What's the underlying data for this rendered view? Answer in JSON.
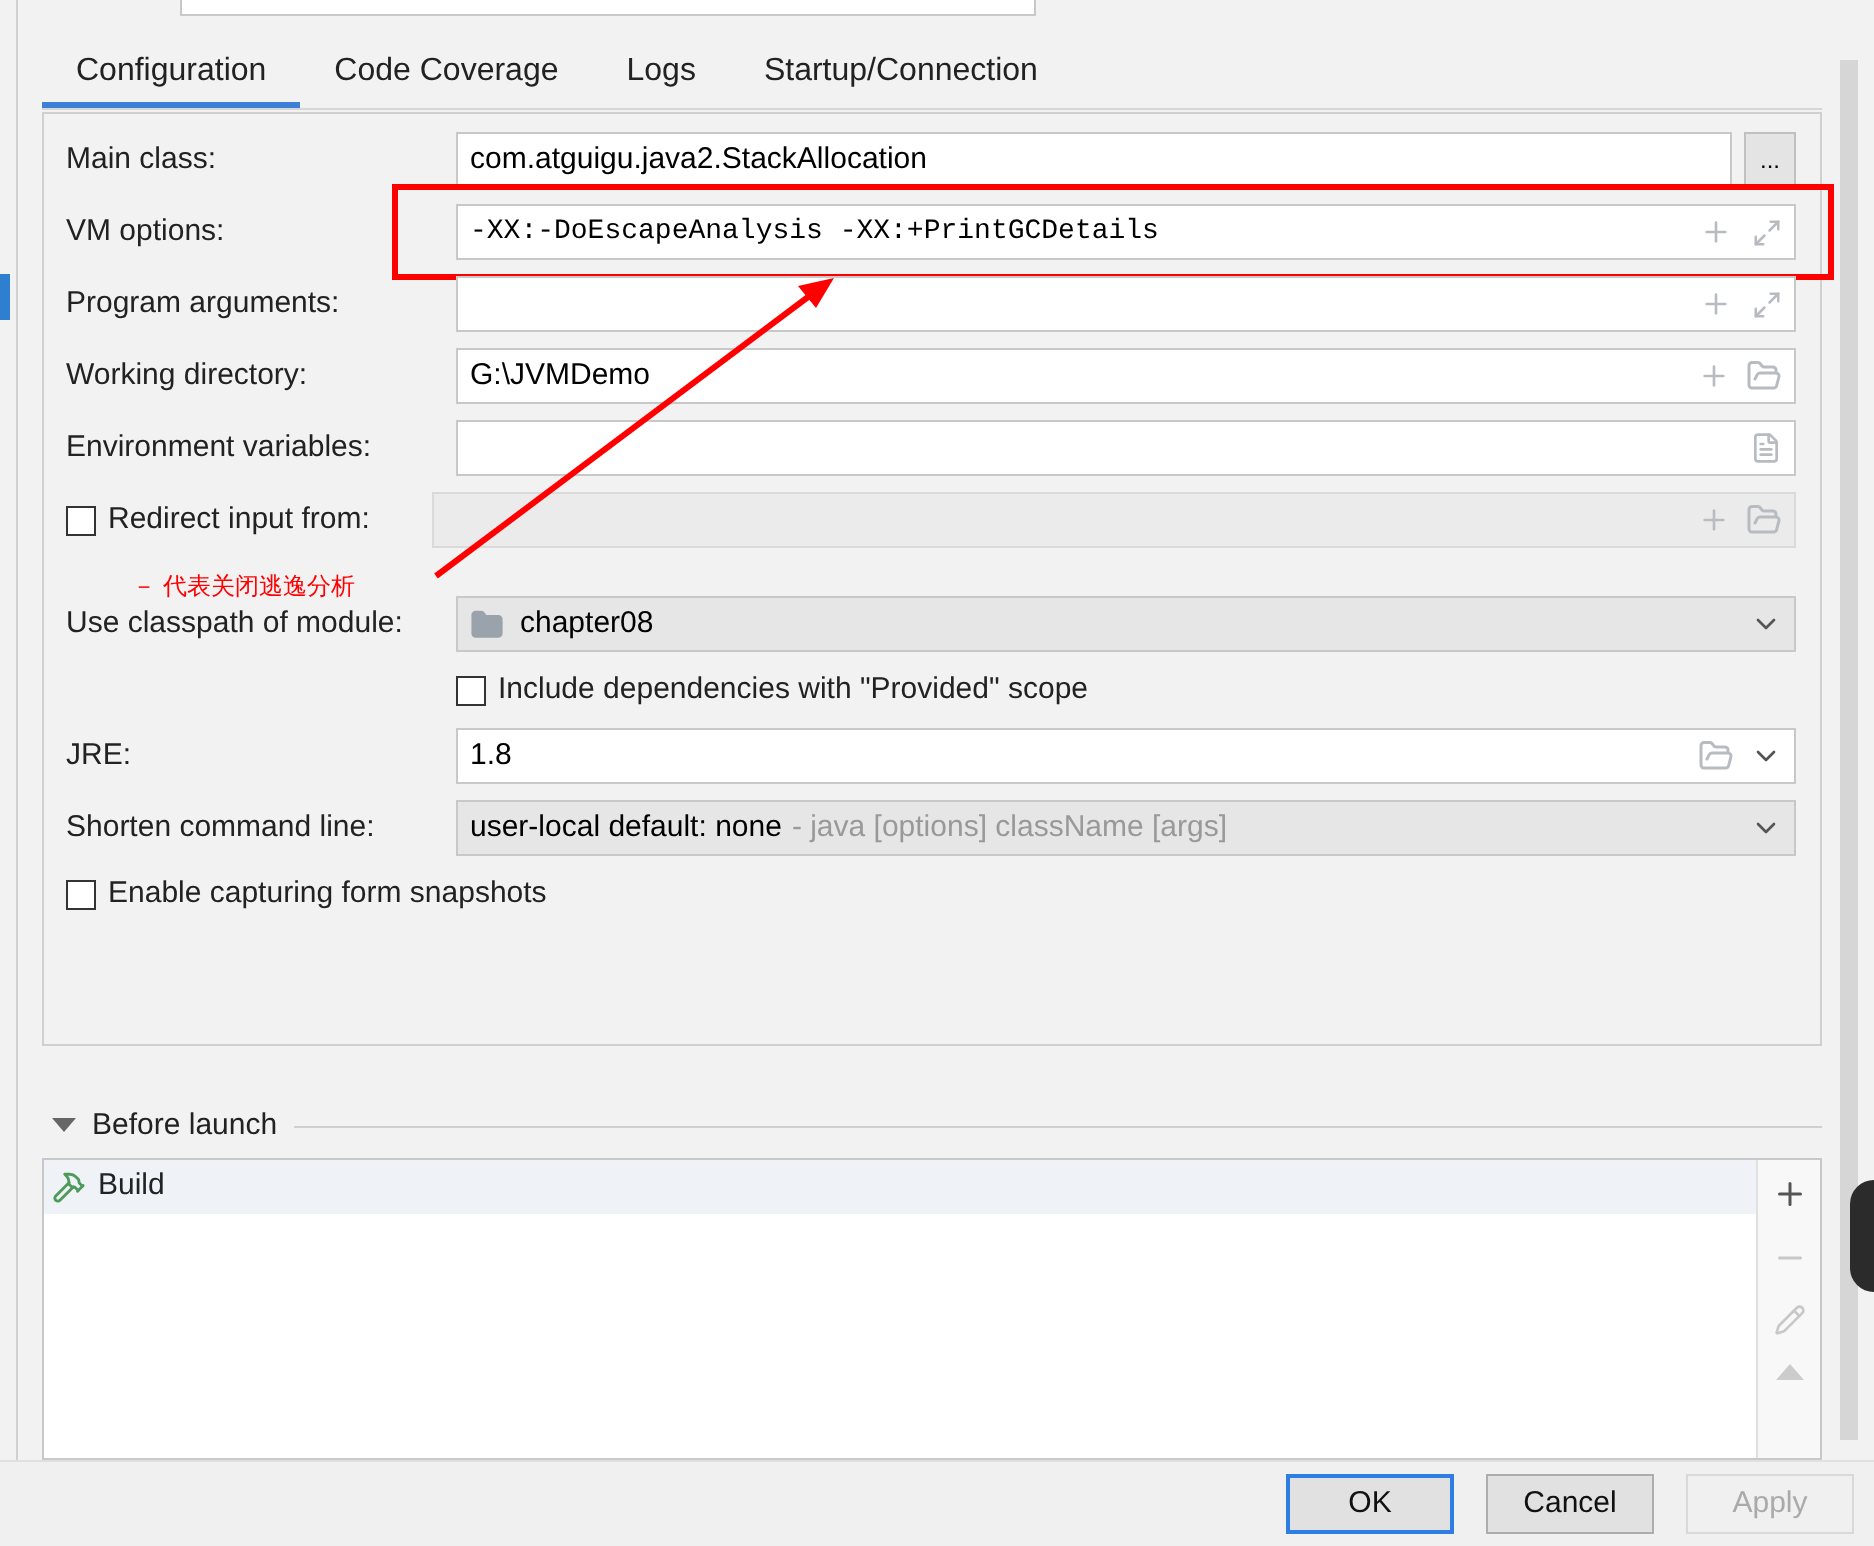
{
  "tabs": [
    {
      "label": "Configuration",
      "selected": true
    },
    {
      "label": "Code Coverage",
      "selected": false
    },
    {
      "label": "Logs",
      "selected": false
    },
    {
      "label": "Startup/Connection",
      "selected": false
    }
  ],
  "fields": [
    {
      "kind": "class",
      "label": "Main class:",
      "value": "com.atguigu.java2.StackAllocation",
      "button": "..."
    },
    {
      "kind": "expand",
      "label": "VM options:",
      "value": "-XX:-DoEscapeAnalysis -XX:+PrintGCDetails",
      "highlighted": true
    },
    {
      "kind": "expand",
      "label": "Program arguments:",
      "highlighted": false
    },
    {
      "kind": "folder",
      "label": "Working directory:",
      "value": "G:\\JVMDemo"
    },
    {
      "kind": "env",
      "label": "Environment variables:"
    },
    {
      "kind": "redirect",
      "label": "Redirect input from:",
      "checked": false
    },
    {
      "kind": "module",
      "label": "Use classpath of module:",
      "value": "chapter08"
    },
    {
      "kind": "checkbox",
      "label": "Include dependencies with \"Provided\" scope",
      "checked": false,
      "indented": true
    },
    {
      "kind": "jre",
      "label": "JRE:",
      "value": "1.8"
    },
    {
      "kind": "shorten",
      "label": "Shorten command line:",
      "value": "user-local default: none",
      "hint": "- java [options] className [args]"
    },
    {
      "kind": "checkbox",
      "label": "Enable capturing form snapshots",
      "checked": false,
      "indented": false
    }
  ],
  "annotation": {
    "note": "－ 代表关闭逃逸分析"
  },
  "before_launch": {
    "title": "Before launch",
    "expanded": true,
    "tasks": [
      {
        "label": "Build",
        "selected": true
      }
    ]
  },
  "buttons": [
    {
      "label": "OK",
      "default": true,
      "disabled": false
    },
    {
      "label": "Cancel",
      "default": false,
      "disabled": false
    },
    {
      "label": "Apply",
      "default": false,
      "disabled": true
    }
  ]
}
